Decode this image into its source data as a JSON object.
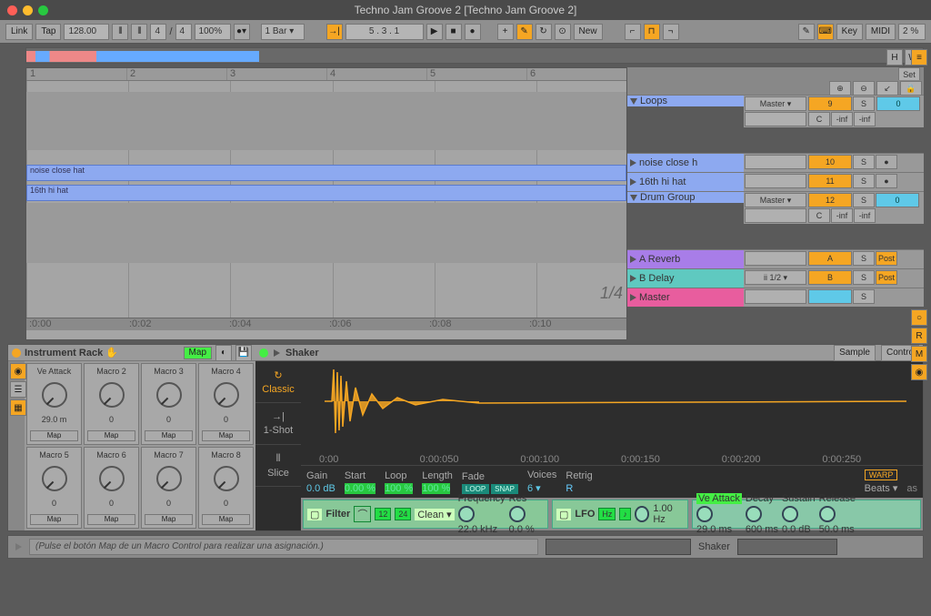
{
  "window": {
    "title": "Techno Jam Groove 2  [Techno Jam Groove 2]"
  },
  "toolbar": {
    "link": "Link",
    "tap": "Tap",
    "tempo": "128.00",
    "sig_num": "4",
    "sig_sep": "/",
    "sig_den": "4",
    "zoom": "100%",
    "quantize": "1 Bar ▾",
    "position": "5 .  3 .  1",
    "new_btn": "New",
    "key": "Key",
    "midi": "MIDI",
    "cpu": "2 %"
  },
  "overview": {
    "h": "H",
    "w": "W"
  },
  "ruler_bars": [
    "1",
    "2",
    "3",
    "4",
    "5",
    "6"
  ],
  "clips": {
    "noise_close_hat": "noise close hat",
    "sixteenth": "16th hi hat"
  },
  "bottom_times": [
    ":0:00",
    ":0:02",
    ":0:04",
    ":0:06",
    ":0:08",
    ":0:10"
  ],
  "fraction": "1/4",
  "set_header": {
    "label": "Set"
  },
  "tracks": {
    "loops": {
      "name": "Loops",
      "route": "Master ▾",
      "vol": "9",
      "solo": "S",
      "send": "0",
      "c": "C",
      "inf1": "-inf",
      "inf2": "-inf"
    },
    "noise": {
      "name": "noise close h",
      "vol": "10",
      "solo": "S"
    },
    "hat": {
      "name": "16th hi hat",
      "vol": "11",
      "solo": "S"
    },
    "drum": {
      "name": "Drum Group",
      "route": "Master ▾",
      "vol": "12",
      "solo": "S",
      "send": "0",
      "c": "C",
      "inf1": "-inf",
      "inf2": "-inf"
    },
    "areverb": {
      "name": "A Reverb",
      "vol": "A",
      "solo": "S",
      "post": "Post"
    },
    "bdelay": {
      "name": "B Delay",
      "route": "ii 1/2 ▾",
      "vol": "B",
      "solo": "S",
      "post": "Post"
    },
    "master": {
      "name": "Master",
      "vol": "",
      "solo": "S"
    }
  },
  "rack": {
    "title": "Instrument Rack ✋",
    "map_btn": "Map",
    "macros": [
      {
        "label": "Ve Attack",
        "val": "29.0 m",
        "map": "Map"
      },
      {
        "label": "Macro 2",
        "val": "0",
        "map": "Map"
      },
      {
        "label": "Macro 3",
        "val": "0",
        "map": "Map"
      },
      {
        "label": "Macro 4",
        "val": "0",
        "map": "Map"
      },
      {
        "label": "Macro 5",
        "val": "0",
        "map": "Map"
      },
      {
        "label": "Macro 6",
        "val": "0",
        "map": "Map"
      },
      {
        "label": "Macro 7",
        "val": "0",
        "map": "Map"
      },
      {
        "label": "Macro 8",
        "val": "0",
        "map": "Map"
      }
    ]
  },
  "sampler": {
    "title": "Shaker",
    "tabs": {
      "sample": "Sample",
      "controls": "Contro"
    },
    "modes": {
      "classic": "Classic",
      "oneshot": "1-Shot",
      "slice": "Slice"
    },
    "wave_times": [
      "0:00",
      "0:00:050",
      "0:00:100",
      "0:00:150",
      "0:00:200",
      "0:00:250"
    ],
    "as_label": "as",
    "params": {
      "gain": {
        "label": "Gain",
        "val": "0.0 dB"
      },
      "start": {
        "label": "Start",
        "val": "0.00 %"
      },
      "loop": {
        "label": "Loop",
        "val": "100 %"
      },
      "length": {
        "label": "Length",
        "val": "100 %"
      },
      "fade": {
        "label": "Fade",
        "loop_tag": "LOOP",
        "snap_tag": "SNAP"
      },
      "voices": {
        "label": "Voices",
        "val": "6 ▾"
      },
      "retrig": {
        "label": "Retrig"
      },
      "warp": {
        "label": "WARP"
      },
      "beats": {
        "label": "Beats ▾"
      }
    }
  },
  "fx": {
    "filter": {
      "title": "Filter",
      "b12": "12",
      "b24": "24",
      "clean": "Clean ▾",
      "freq": "Frequency",
      "freq_val": "22.0 kHz",
      "res": "Res",
      "res_val": "0.0 %"
    },
    "lfo": {
      "title": "LFO",
      "hz": "Hz",
      "rate": "1.00 Hz"
    },
    "env": {
      "atk": {
        "label": "Ve Attack",
        "val": "29.0 ms"
      },
      "dec": {
        "label": "Decay",
        "val": "600 ms"
      },
      "sus": {
        "label": "Sustain",
        "val": "0.0 dB"
      },
      "rel": {
        "label": "Release",
        "val": "50.0 ms"
      }
    }
  },
  "status": {
    "hint": "(Pulse el botón Map de un Macro Control para realizar una asignación.)",
    "device": "Shaker"
  }
}
